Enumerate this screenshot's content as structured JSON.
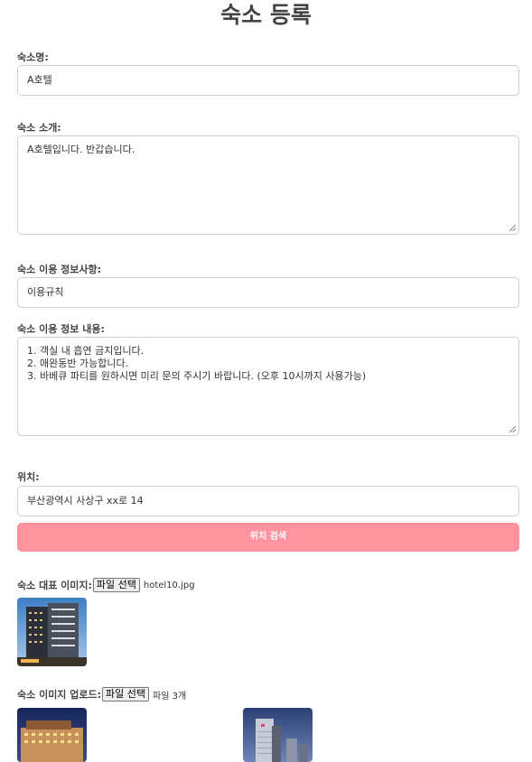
{
  "page": {
    "title": "숙소 등록"
  },
  "form": {
    "name": {
      "label": "숙소명:",
      "value": "A호텔"
    },
    "intro": {
      "label": "숙소 소개:",
      "value": "A호텔입니다. 반갑습니다."
    },
    "info_title": {
      "label": "숙소 이용 정보사항:",
      "value": "이용규칙"
    },
    "info_content": {
      "label": "숙소 이용 정보 내용:",
      "lines": [
        "1. 객실 내 흡연 금지입니다.",
        "2. 애완동반 가능합니다.",
        "3. 바베큐 파티를 원하시면 미리 문의 주시기 바랍니다. (오후 10시까지 사용가능)"
      ]
    },
    "location": {
      "label": "위치:",
      "value": "부산광역시 사상구 xx로 14",
      "search_button": "위치 검색"
    },
    "main_image": {
      "label": "숙소 대표 이미지:",
      "button": "파일 선택",
      "file_name": "hotel10.jpg"
    },
    "images": {
      "label": "숙소 이미지 업로드:",
      "button": "파일 선택",
      "file_count": "파일 3개"
    }
  },
  "colors": {
    "accent": "#ff94a0",
    "border": "#cfcfcf"
  },
  "icons": {
    "resize": "textarea-resize-handle"
  }
}
